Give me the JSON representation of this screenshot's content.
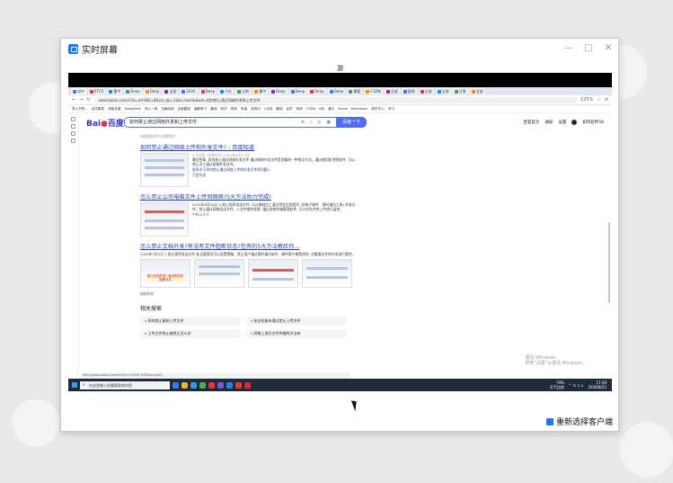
{
  "app": {
    "title": "实时屏幕",
    "controls": [
      "—",
      "□",
      "✕"
    ],
    "reselect_label": "重新选择客户端"
  },
  "remote": {
    "top_title": "游",
    "tabs": [
      "如何",
      "ETCX",
      "重中",
      "Deep",
      "Deep",
      "全部",
      "2026",
      "Deep",
      "小红",
      "以前",
      "重中",
      "Deep",
      "Deep",
      "Deep",
      "Deep",
      "重要",
      "CSDN",
      "全部",
      "复制",
      "全部",
      "全部",
      "注意",
      "全部"
    ],
    "url": "www.baidu.com/s?ie=utf-8&f=8&rsv_bp=1&tn=baidu&wd=如何禁止通过网络外发和上传文件",
    "zoom": "125%",
    "bookmarks": [
      "导入书签...",
      "会员服务",
      "领取全套",
      "DeepSeek",
      "安心一家",
      "文献阅读",
      "百度翻译",
      "编程练习",
      "翻译",
      "知识",
      "知网",
      "有道",
      "全球AI",
      "1分钟",
      "翻译",
      "会员",
      "官网",
      "CSDN",
      "B站",
      "通义",
      "Bryan",
      "Markdown",
      "软件中心",
      "学习"
    ],
    "search_query": "如何禁止通过网络外发和上传文件",
    "search_button": "百度一下",
    "head_links": [
      "百度首页",
      "通知",
      "设置",
      "如何软件58"
    ],
    "prev_meta": "电脑版软件在线看图片",
    "results": [
      {
        "title_pre": "如何禁止通过网络上传和外发文件? - 百度知道",
        "meta": "1个回答 · 回答时间: 2025年8月17日",
        "text": "最佳答案: 如何禁止通过网络外发文件 通过网络外发文件是泄露的一种常见方式。通过使用防泄密软件, 可以禁止员工通过网络外发文件。",
        "more": "更多关于如何禁止通过网络上传和外发文件的问题>",
        "source": "百度知道"
      },
      {
        "title_pre": "怎么禁止公司电脑文件上传到网络?5大方法助力完成!",
        "text": "2025年8月18日 4.禁止程序发送文件: 可以限制员工通过特定应用程序 (如电子邮件、即时通讯工具) 外发文件。禁止通过网络发送文件。5.文件操作权限: 通过安装终端管理软件, 可以对文件的上传进行监控。",
        "source": "中科公众号"
      },
      {
        "title_pre": "怎么禁止文档外发?有没有文件阻断日志?包有的5大方法教给你...",
        "text": "2025年7月3日 1.禁止程序发送文件 安全管理员可以设置策略。禁止用户通过即时通讯软件、邮件客户端等途径, 对重要文件的外发进行管控。",
        "thumb_caption": "禁止文档外发? 有没有文件阻断日志",
        "source": "网络科技"
      }
    ],
    "related_title": "相关搜索",
    "related": [
      "如何禁止复制上传文件",
      "安全检查未通过禁止上传文件",
      "上传文件禁止被禁止怎么办",
      "网络上进行文件传输的方法有"
    ],
    "watermark_line1": "激活 Windows",
    "watermark_line2": "转到\"设置\"以激活 Windows。",
    "status_url": "http://www.baidu.com/link?url=E0rMr7k1kExmy4eG...",
    "taskbar_search": "在这里输入你要搜索的内容",
    "tray_weather": "79%",
    "tray_weather2": "天气比较",
    "tray_time": "17:28",
    "tray_date": "2026/8/22"
  }
}
